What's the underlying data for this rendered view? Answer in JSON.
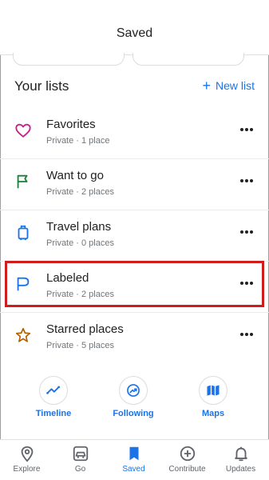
{
  "header": {
    "title": "Saved"
  },
  "lists": {
    "title": "Your lists",
    "new_list_label": "New list",
    "items": [
      {
        "name": "Favorites",
        "meta": "Private · 1 place",
        "icon": "heart-icon"
      },
      {
        "name": "Want to go",
        "meta": "Private · 2 places",
        "icon": "flag-icon"
      },
      {
        "name": "Travel plans",
        "meta": "Private · 0 places",
        "icon": "suitcase-icon"
      },
      {
        "name": "Labeled",
        "meta": "Private · 2 places",
        "icon": "label-flag-icon"
      },
      {
        "name": "Starred places",
        "meta": "Private · 5 places",
        "icon": "star-icon"
      }
    ]
  },
  "shortcuts": [
    {
      "label": "Timeline",
      "icon": "timeline-icon"
    },
    {
      "label": "Following",
      "icon": "following-icon"
    },
    {
      "label": "Maps",
      "icon": "map-icon"
    }
  ],
  "bottom_nav": [
    {
      "label": "Explore",
      "icon": "location-pin-icon"
    },
    {
      "label": "Go",
      "icon": "car-icon"
    },
    {
      "label": "Saved",
      "icon": "bookmark-icon",
      "active": true
    },
    {
      "label": "Contribute",
      "icon": "add-circle-icon"
    },
    {
      "label": "Updates",
      "icon": "bell-icon"
    }
  ],
  "colors": {
    "accent": "#1a73e8",
    "favorites": "#c5218a",
    "want_to_go": "#188038",
    "travel": "#1a73e8",
    "labeled": "#1a73e8",
    "starred": "#b06000",
    "highlight_box": "#d01c1c"
  }
}
